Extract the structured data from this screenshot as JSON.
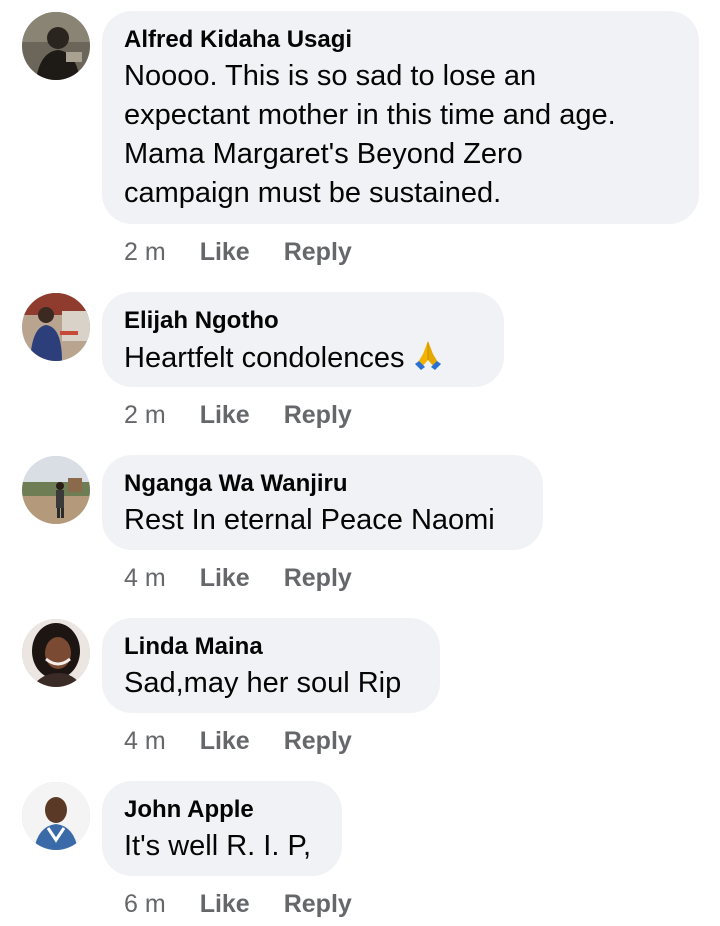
{
  "comments": [
    {
      "author": "Alfred Kidaha Usagi",
      "text": "Noooo. This is so sad to lose an expectant mother in this time and age. Mama Margaret's Beyond Zero campaign must be sustained.",
      "lines": [
        "Noooo. This is so sad to lose an",
        "expectant mother in this time and age.",
        "Mama Margaret's Beyond Zero",
        "campaign must be sustained."
      ],
      "time": "2 m",
      "like_label": "Like",
      "reply_label": "Reply"
    },
    {
      "author": "Elijah Ngotho",
      "text": "Heartfelt condolences",
      "emoji": "folded-hands-icon",
      "time": "2 m",
      "like_label": "Like",
      "reply_label": "Reply"
    },
    {
      "author": "Nganga Wa Wanjiru",
      "text": "Rest In eternal Peace Naomi",
      "time": "4 m",
      "like_label": "Like",
      "reply_label": "Reply"
    },
    {
      "author": "Linda Maina",
      "text": "Sad,may her soul Rip",
      "time": "4 m",
      "like_label": "Like",
      "reply_label": "Reply"
    },
    {
      "author": "John Apple",
      "text": "It's well R. I. P,",
      "time": "6 m",
      "like_label": "Like",
      "reply_label": "Reply"
    }
  ],
  "colors": {
    "bubble_bg": "#f0f2f5",
    "text": "#050505",
    "meta_text": "#65676b",
    "emoji_hands": "#f2b400",
    "emoji_sleeve": "#2a6fd6"
  }
}
